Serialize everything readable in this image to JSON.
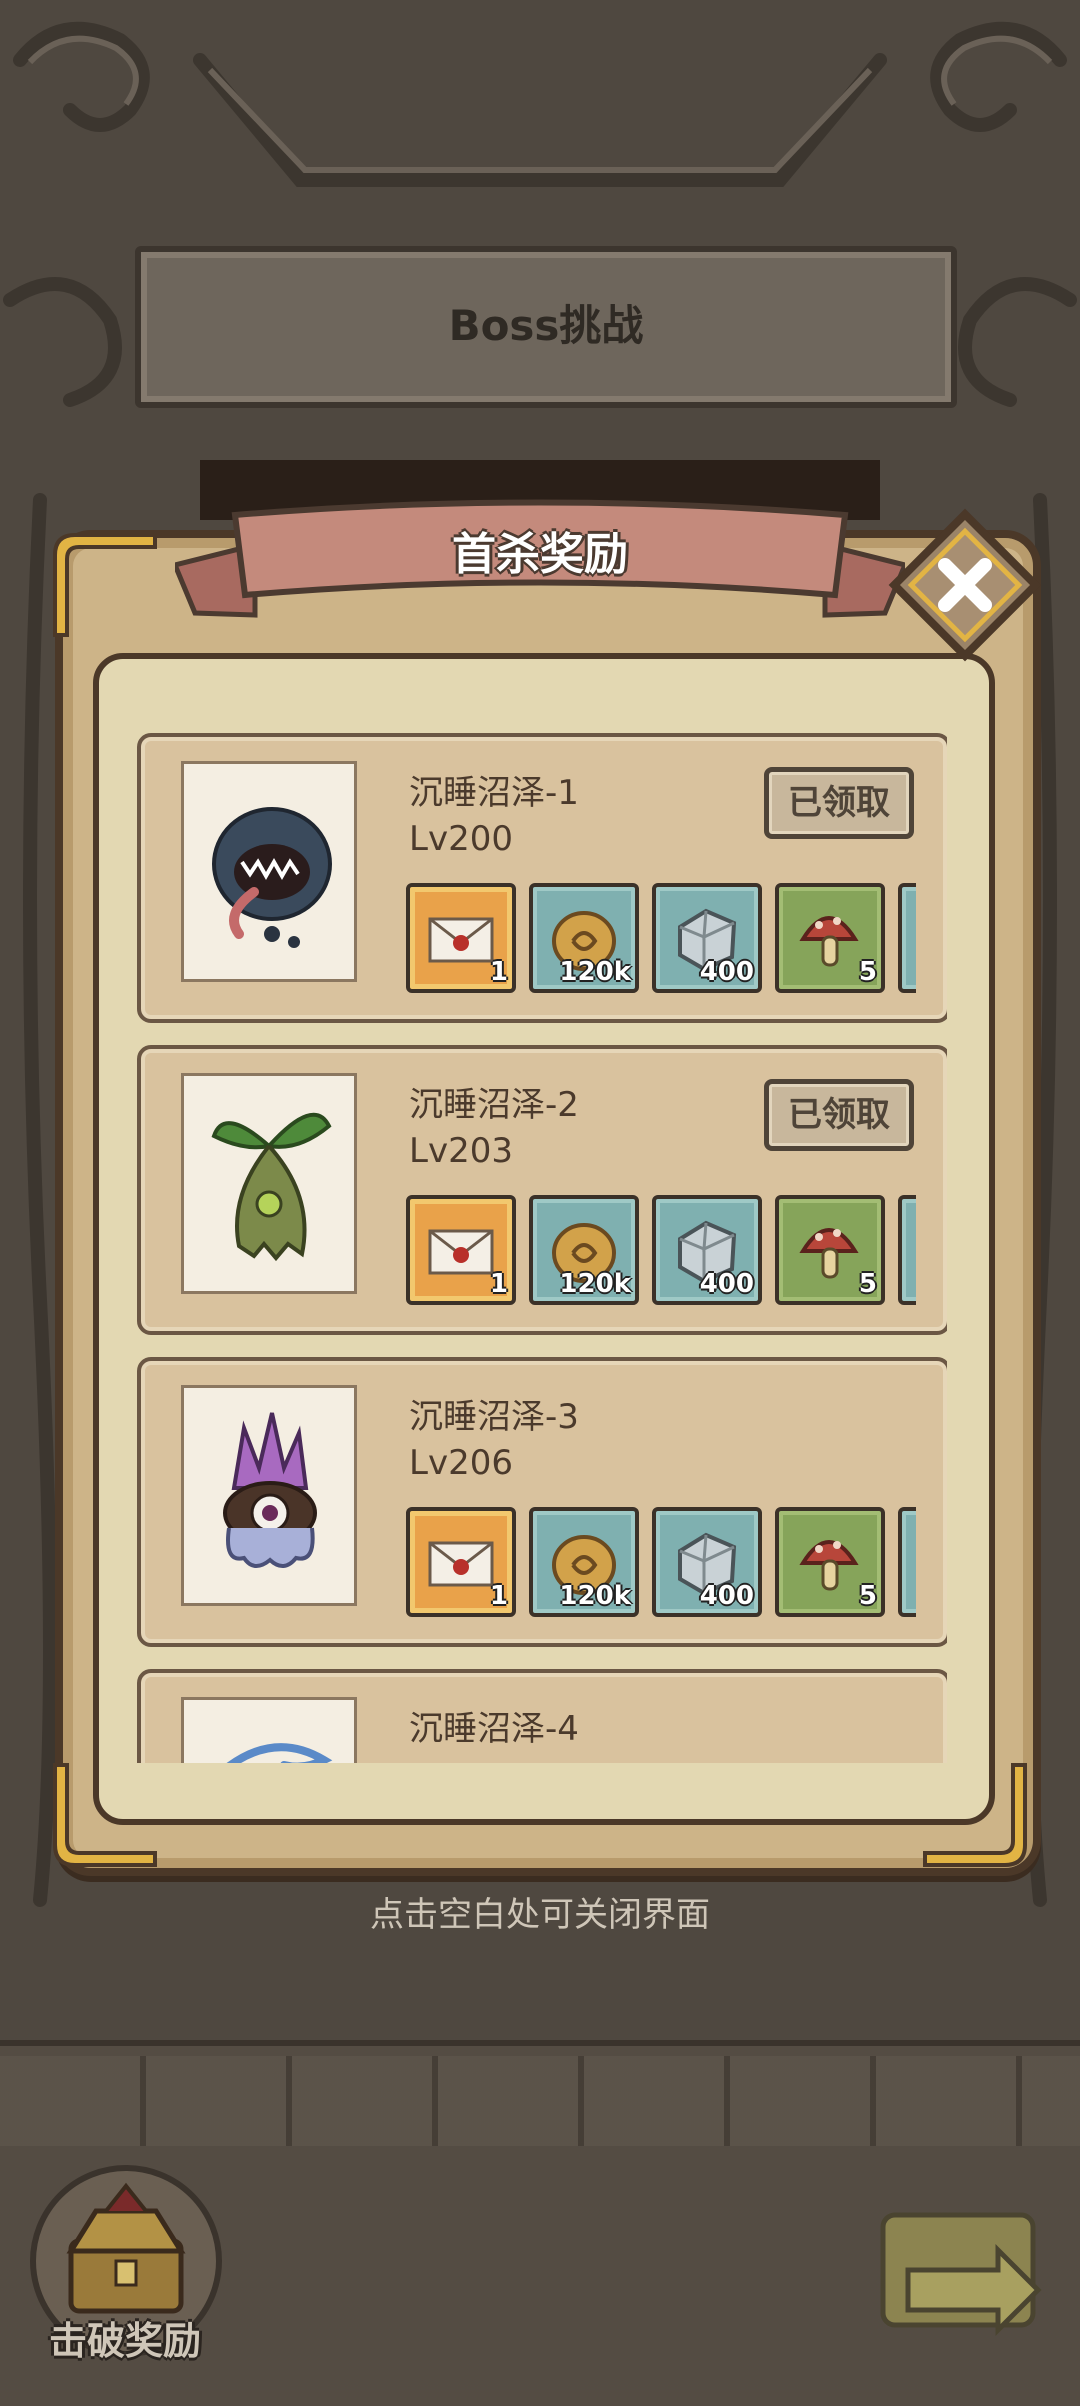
{
  "header": {
    "title": "Boss挑战"
  },
  "popup": {
    "title": "首杀奖励",
    "close_icon": "close-x-icon",
    "hint": "点击空白处可关闭界面"
  },
  "rewards": [
    {
      "stage": "沉睡沼泽-1",
      "level": "Lv200",
      "status": "已领取",
      "portrait": "dark-blue-mouth-slime",
      "items": [
        {
          "icon": "letter-icon",
          "count": "1"
        },
        {
          "icon": "coin-icon",
          "count": "120k"
        },
        {
          "icon": "ore-icon",
          "count": "400"
        },
        {
          "icon": "mushroom-icon",
          "count": "5"
        }
      ]
    },
    {
      "stage": "沉睡沼泽-2",
      "level": "Lv203",
      "status": "已领取",
      "portrait": "green-seed-sprout",
      "items": [
        {
          "icon": "letter-icon",
          "count": "1"
        },
        {
          "icon": "coin-icon",
          "count": "120k"
        },
        {
          "icon": "ore-icon",
          "count": "400"
        },
        {
          "icon": "mushroom-icon",
          "count": "5"
        }
      ]
    },
    {
      "stage": "沉睡沼泽-3",
      "level": "Lv206",
      "status": "",
      "portrait": "crystal-eye-creature",
      "items": [
        {
          "icon": "letter-icon",
          "count": "1"
        },
        {
          "icon": "coin-icon",
          "count": "120k"
        },
        {
          "icon": "ore-icon",
          "count": "400"
        },
        {
          "icon": "mushroom-icon",
          "count": "5"
        }
      ]
    },
    {
      "stage": "沉睡沼泽-4",
      "portrait": "blue-water-creature"
    }
  ],
  "bottom": {
    "defeat_reward_label": "击破奖励",
    "return_icon": "return-arrow-icon"
  }
}
